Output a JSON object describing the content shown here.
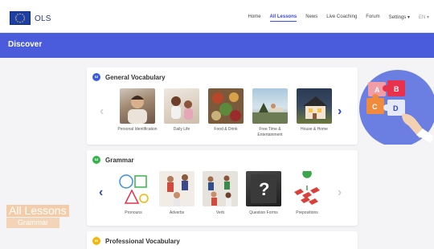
{
  "header": {
    "logo_text": "OLS",
    "nav": [
      {
        "label": "Home"
      },
      {
        "label": "All Lessons"
      },
      {
        "label": "News"
      },
      {
        "label": "Live Coaching"
      },
      {
        "label": "Forum"
      },
      {
        "label": "Settings ▾"
      },
      {
        "label": "EN ▾"
      }
    ]
  },
  "band": {
    "title": "Discover"
  },
  "sections": [
    {
      "title": "General Vocabulary",
      "badge_color": "#3b5bdb",
      "items": [
        {
          "label": "Personal Identification"
        },
        {
          "label": "Daily Life"
        },
        {
          "label": "Food & Drink"
        },
        {
          "label": "Free Time & Entertainment"
        },
        {
          "label": "House & Home"
        }
      ]
    },
    {
      "title": "Grammar",
      "badge_color": "#37b24d",
      "items": [
        {
          "label": "Pronouns"
        },
        {
          "label": "Adverbs"
        },
        {
          "label": "Verb"
        },
        {
          "label": "Question Forms"
        },
        {
          "label": "Prepositions"
        }
      ]
    },
    {
      "title": "Professional Vocabulary",
      "badge_color": "#f2b705",
      "items": []
    }
  ],
  "side": {
    "title": "All Lessons",
    "subtitle": "Grammar"
  },
  "puzzle": {
    "pieces": [
      "A",
      "B",
      "C",
      "D"
    ]
  },
  "icons": {
    "prev": "‹",
    "next": "›",
    "question": "?"
  }
}
